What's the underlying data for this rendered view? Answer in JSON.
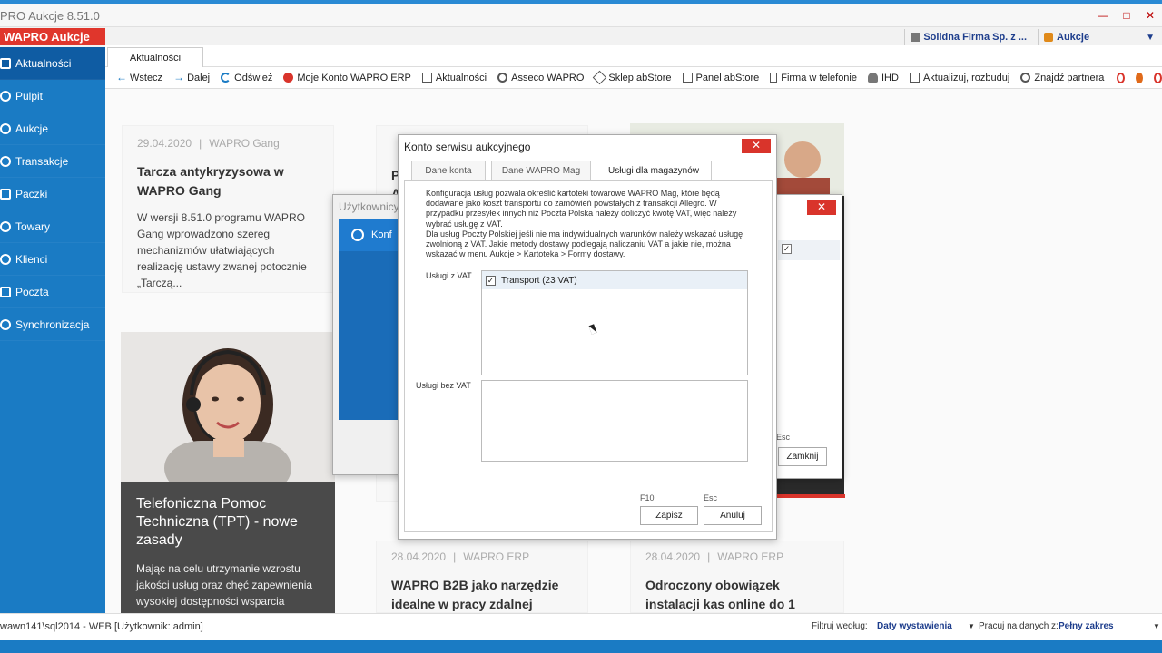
{
  "window": {
    "title": "PRO Aukcje 8.51.0",
    "brand": "WAPRO Aukcje"
  },
  "topright": {
    "company": "Solidna Firma Sp. z ...",
    "module": "Aukcje"
  },
  "sidebar": {
    "items": [
      {
        "label": "Aktualności"
      },
      {
        "label": "Pulpit"
      },
      {
        "label": "Aukcje"
      },
      {
        "label": "Transakcje"
      },
      {
        "label": "Paczki"
      },
      {
        "label": "Towary"
      },
      {
        "label": "Klienci"
      },
      {
        "label": "Poczta"
      },
      {
        "label": "Synchronizacja"
      }
    ]
  },
  "tabs": [
    {
      "label": "Aktualności"
    }
  ],
  "toolbar": {
    "items": [
      {
        "label": "Wstecz",
        "icon": "arrow-left-icon"
      },
      {
        "label": "Dalej",
        "icon": "arrow-right-icon"
      },
      {
        "label": "Odśwież",
        "icon": "refresh-icon"
      },
      {
        "label": "Moje Konto WAPRO ERP",
        "icon": "account-icon"
      },
      {
        "label": "Aktualności",
        "icon": "news-icon"
      },
      {
        "label": "Asseco WAPRO",
        "icon": "asseco-icon"
      },
      {
        "label": "Sklep abStore",
        "icon": "store-icon"
      },
      {
        "label": "Panel abStore",
        "icon": "panel-icon"
      },
      {
        "label": "Firma w telefonie",
        "icon": "phone-icon"
      },
      {
        "label": "IHD",
        "icon": "user-icon"
      },
      {
        "label": "Aktualizuj, rozbuduj",
        "icon": "update-icon"
      },
      {
        "label": "Znajdź partnera",
        "icon": "find-icon"
      }
    ]
  },
  "news": {
    "card1": {
      "date": "29.04.2020",
      "category": "WAPRO Gang",
      "title": "Tarcza antykryzysowa w WAPRO Gang",
      "body": "W wersji 8.51.0 programu WAPRO Gang wprowadzono szereg mechanizmów ułatwiających realizację ustawy zwanej potocznie „Tarczą..."
    },
    "card2": {
      "title": "Telefoniczna Pomoc Techniczna (TPT) - nowe zasady",
      "body": "Mając na celu utrzymanie wzrostu jakości usług oraz chęć zapewnienia wysokiej dostępności wsparcia"
    },
    "card3": {
      "date": "28.04.2020",
      "category": "WAPRO ERP",
      "title": "WAPRO B2B jako narzędzie idealne w pracy zdalnej"
    },
    "card4": {
      "date": "28.04.2020",
      "category": "WAPRO ERP",
      "title": "Odroczony obowiązek instalacji kas online do 1 stycznia 2021 r."
    },
    "hidden_letters": {
      "p": "P",
      "a": "A"
    }
  },
  "back_dialog": {
    "title": "Użytkownicy",
    "row": "Konf"
  },
  "right_dialog": {
    "close_label": "Zamknij",
    "esc": "Esc"
  },
  "dialog": {
    "title": "Konto serwisu aukcyjnego",
    "tabs": [
      {
        "label": "Dane konta"
      },
      {
        "label": "Dane WAPRO Mag"
      },
      {
        "label": "Usługi dla magazynów"
      }
    ],
    "description": "Konfiguracja usług pozwala określić kartoteki towarowe WAPRO Mag, które będą dodawane jako koszt transportu do zamówień powstałych z transakcji Allegro. W przypadku przesyłek innych niż Poczta Polska należy doliczyć kwotę VAT, więc należy wybrać usługę z VAT.\nDla usług Poczty Polskiej jeśli nie ma indywidualnych warunków należy wskazać usługę zwolnioną z VAT. Jakie metody dostawy podlegają naliczaniu VAT a jakie nie, można wskazać w menu Aukcje > Kartoteka > Formy dostawy.",
    "vat_label": "Usługi z VAT",
    "vat_items": [
      {
        "label": "Transport (23  VAT)",
        "checked": true
      }
    ],
    "novat_label": "Usługi bez VAT",
    "save_key": "F10",
    "cancel_key": "Esc",
    "save_label": "Zapisz",
    "cancel_label": "Anuluj"
  },
  "status": {
    "connection": "wawn141\\sql2014 - WEB [Użytkownik: admin]",
    "filter_label": "Filtruj według:",
    "filter_value": "Daty wystawienia",
    "range_label": "Pracuj na danych z:",
    "range_value": "Pełny zakres"
  },
  "colors": {
    "accent": "#1a7bc4",
    "brand": "#e0362c",
    "close": "#d9342b"
  }
}
